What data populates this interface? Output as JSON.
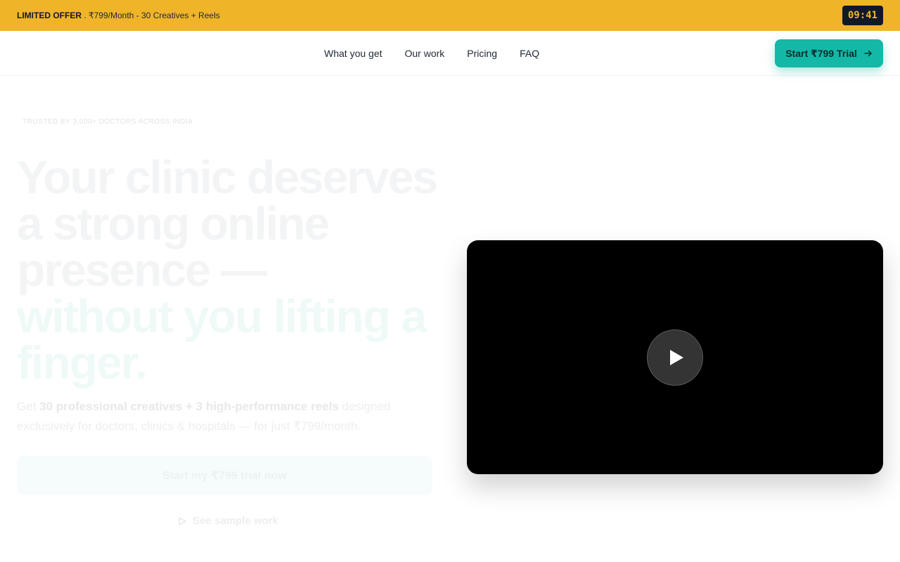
{
  "topbar": {
    "offer_strong": "LIMITED OFFER",
    "offer_text": " . ₹799/Month - 30 Creatives + Reels",
    "timer": "09:41"
  },
  "nav": {
    "links": [
      "What you get",
      "Our work",
      "Pricing",
      "FAQ"
    ],
    "cta_label": "Start ₹799 Trial"
  },
  "hero": {
    "eyebrow": "TRUSTED BY 3,000+ DOCTORS ACROSS INDIA",
    "headline_1": "Your clinic deserves",
    "headline_2": "a strong online",
    "headline_3": "presence —",
    "headline_accent_1": "without you lifting a",
    "headline_accent_2": "finger.",
    "sub_prefix": "Get ",
    "sub_bold": "30 professional creatives + 3 high-performance reels",
    "sub_suffix": " designed exclusively for doctors, clinics & hospitals — for just ₹799/month.",
    "primary_button": "Start my ₹799 trial now",
    "secondary_link": "See sample work"
  },
  "video": {
    "play_icon": "play-icon"
  },
  "colors": {
    "offer_bar": "#f0b429",
    "accent": "#14b8a6",
    "timer_bg": "#111827"
  }
}
